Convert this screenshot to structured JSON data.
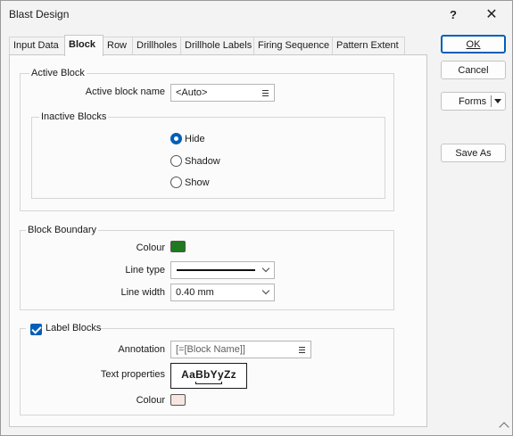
{
  "window": {
    "title": "Blast Design"
  },
  "titlebar": {
    "help_label": "?",
    "close_label": "✕"
  },
  "tabs": [
    {
      "label": "Input Data",
      "active": false
    },
    {
      "label": "Block",
      "active": true
    },
    {
      "label": "Row",
      "active": false
    },
    {
      "label": "Drillholes",
      "active": false
    },
    {
      "label": "Drillhole Labels",
      "active": false
    },
    {
      "label": "Firing Sequence",
      "active": false
    },
    {
      "label": "Pattern Extent",
      "active": false
    }
  ],
  "active_block": {
    "group_title": "Active Block",
    "name_label": "Active block name",
    "name_value": "<Auto>",
    "inactive": {
      "group_title": "Inactive Blocks",
      "options": [
        {
          "label": "Hide",
          "selected": true
        },
        {
          "label": "Shadow",
          "selected": false
        },
        {
          "label": "Show",
          "selected": false
        }
      ]
    }
  },
  "block_boundary": {
    "group_title": "Block Boundary",
    "colour_label": "Colour",
    "colour_value": "#1f7a1f",
    "line_type_label": "Line type",
    "line_width_label": "Line width",
    "line_width_value": "0.40 mm"
  },
  "label_blocks": {
    "checkbox_label": "Label Blocks",
    "checked": true,
    "annotation_label": "Annotation",
    "annotation_value": "[=[Block Name]]",
    "text_properties_label": "Text properties",
    "text_sample": "AaBbYyZz",
    "colour_label": "Colour",
    "colour_value": "#f7e6df"
  },
  "buttons": {
    "ok": "OK",
    "cancel": "Cancel",
    "forms": "Forms",
    "save_as": "Save As"
  },
  "colors": {
    "accent": "#005fb8",
    "window_bg": "#f3f3f3",
    "panel_bg": "#fbfbfb"
  }
}
